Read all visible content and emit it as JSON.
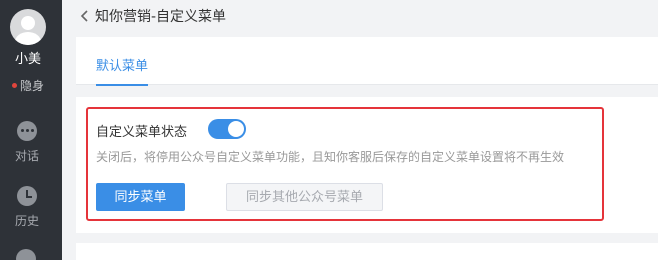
{
  "user": {
    "name": "小美",
    "status": "隐身"
  },
  "nav": {
    "chat_label": "对话",
    "history_label": "历史"
  },
  "header": {
    "title": "知你营销-自定义菜单"
  },
  "tabs": [
    {
      "label": "默认菜单"
    }
  ],
  "menu_settings": {
    "title": "自定义菜单状态",
    "toggle_on": true,
    "description": "关闭后，将停用公众号自定义菜单功能，且知你客服后保存的自定义菜单设置将不再生效",
    "sync_button": "同步菜单",
    "sync_other_button": "同步其他公众号菜单"
  },
  "colors": {
    "accent": "#3a8ee6",
    "highlight_border": "#e5343a",
    "sidebar_bg": "#2e3238",
    "status_dot": "#e0453c"
  }
}
